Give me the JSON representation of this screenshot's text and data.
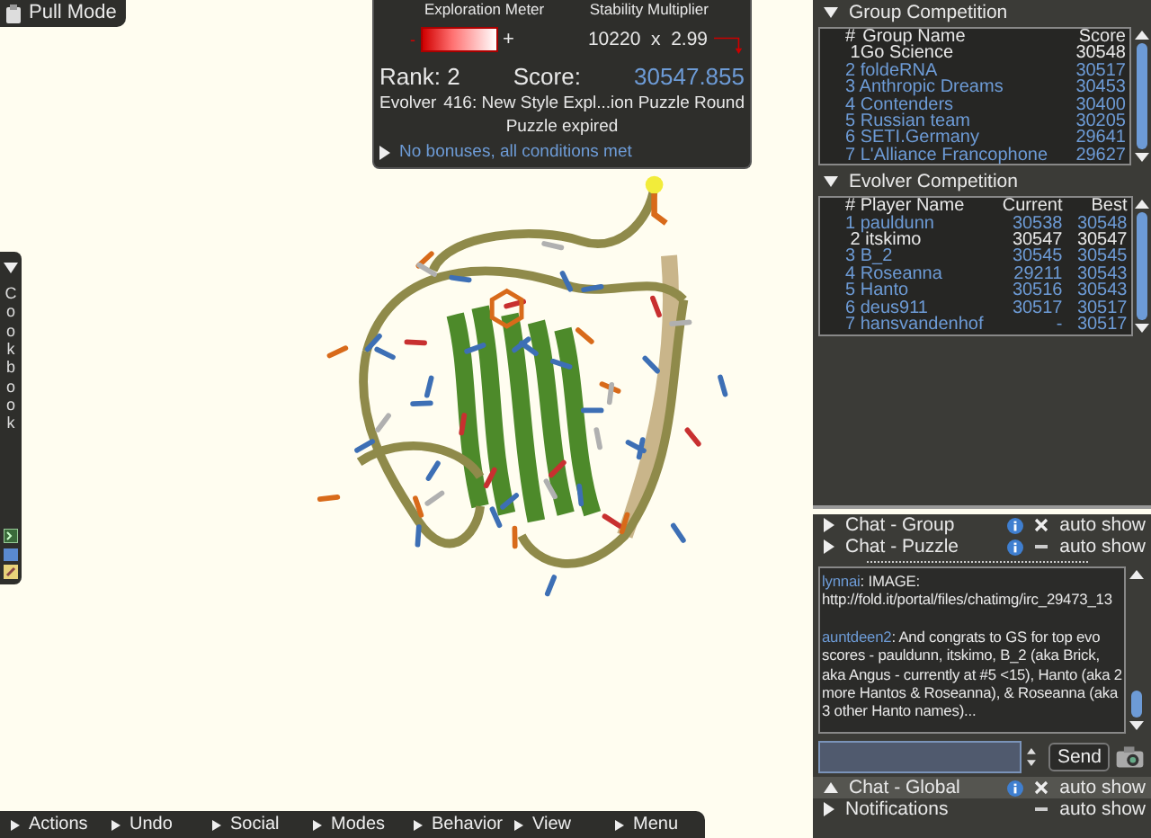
{
  "pull_mode": {
    "label": "Pull Mode"
  },
  "cookbook": {
    "title": "Cookbook",
    "expanded": true
  },
  "score_panel": {
    "exploration_label": "Exploration Meter",
    "minus": "-",
    "plus": "+",
    "stability_label": "Stability Multiplier",
    "stability_value": "10220  x  2.99",
    "rank": "Rank: 2",
    "score_label": "Score:",
    "score": "30547.855",
    "player": "Evolver",
    "puzzle": "416: New Style Expl...ion Puzzle Round",
    "status": "Puzzle expired",
    "bonus": {
      "text": "No bonuses, all conditions met",
      "expanded": false
    }
  },
  "group_competition": {
    "title": "Group Competition",
    "expanded": true,
    "columns": [
      "#",
      "Group Name",
      "Score"
    ],
    "rows": [
      {
        "rank": "1",
        "name": "Go Science",
        "score": "30548",
        "own": true
      },
      {
        "rank": "2",
        "name": "foldeRNA",
        "score": "30517",
        "own": false
      },
      {
        "rank": "3",
        "name": "Anthropic Dreams",
        "score": "30453",
        "own": false
      },
      {
        "rank": "4",
        "name": "Contenders",
        "score": "30400",
        "own": false
      },
      {
        "rank": "5",
        "name": "Russian team",
        "score": "30205",
        "own": false
      },
      {
        "rank": "6",
        "name": "SETI.Germany",
        "score": "29641",
        "own": false
      },
      {
        "rank": "7",
        "name": "L'Alliance Francophone",
        "score": "29627",
        "own": false
      }
    ]
  },
  "evolver_competition": {
    "title": "Evolver Competition",
    "expanded": true,
    "columns": [
      "# Player Name",
      "Current",
      "Best"
    ],
    "rows": [
      {
        "rank": "1",
        "name": "pauldunn",
        "current": "30538",
        "best": "30548",
        "own": false
      },
      {
        "rank": "2",
        "name": "itskimo",
        "current": "30547",
        "best": "30547",
        "own": true
      },
      {
        "rank": "3",
        "name": "B_2",
        "current": "30545",
        "best": "30545",
        "own": false
      },
      {
        "rank": "4",
        "name": "Roseanna",
        "current": "29211",
        "best": "30543",
        "own": false
      },
      {
        "rank": "5",
        "name": "Hanto",
        "current": "30516",
        "best": "30543",
        "own": false
      },
      {
        "rank": "6",
        "name": "deus911",
        "current": "30517",
        "best": "30517",
        "own": false
      },
      {
        "rank": "7",
        "name": "hansvandenhof",
        "current": "-",
        "best": "30517",
        "own": false
      }
    ]
  },
  "chat": {
    "top_sections": [
      {
        "title": "Chat - Group",
        "expanded": false,
        "info": true,
        "auto_show": true,
        "auto_label": "auto show"
      },
      {
        "title": "Chat - Puzzle",
        "expanded": false,
        "info": true,
        "auto_show": false,
        "auto_label": "auto show"
      }
    ],
    "messages": [
      {
        "user": "lynnai",
        "text": ": IMAGE: http://fold.it/portal/files/chatimg/irc_29473_13"
      },
      {
        "user": "auntdeen2",
        "text": ": And congrats to GS for top evo scores - pauldunn, itskimo, B_2 (aka Brick, aka Angus - currently at #5 <15), Hanto (aka 2 more Hantos & Roseanna), & Roseanna (aka 3 other Hanto names)..."
      }
    ],
    "send": "Send",
    "bottom_sections": [
      {
        "title": "Chat - Global",
        "expanded": true,
        "info": true,
        "auto_show": true,
        "auto_label": "auto show"
      },
      {
        "title": "Notifications",
        "expanded": false,
        "info": false,
        "auto_show": false,
        "auto_label": "auto show"
      }
    ]
  },
  "toolbar": [
    "Actions",
    "Undo",
    "Social",
    "Modes",
    "Behavior",
    "View",
    "Menu"
  ]
}
